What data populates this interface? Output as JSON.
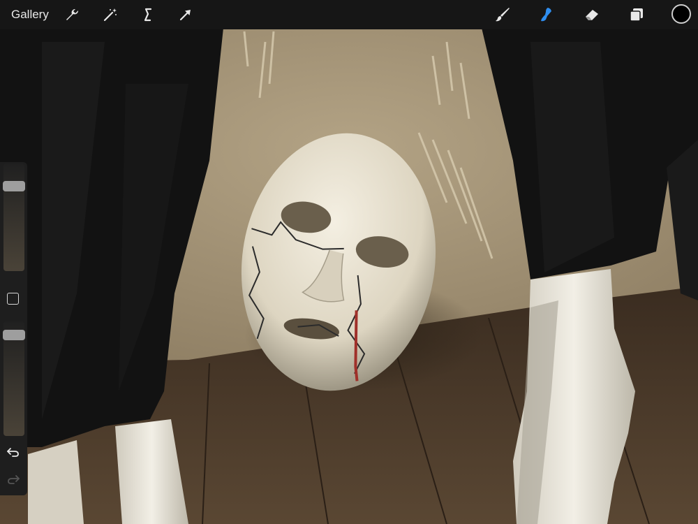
{
  "toolbar": {
    "gallery_label": "Gallery",
    "left_tools": [
      "wrench-icon",
      "magic-wand-icon",
      "selection-icon",
      "transform-arrow-icon"
    ],
    "right_tools": [
      "brush-icon",
      "smudge-icon",
      "eraser-icon",
      "layers-icon"
    ],
    "active_tool": "smudge",
    "accent_color": "#2f8ef0",
    "current_color": "#000000"
  },
  "sidebar": {
    "brush_size_level": 0.82,
    "opacity_level": 0.92,
    "controls": [
      "modify-button",
      "undo-icon",
      "redo-icon"
    ]
  },
  "canvas": {
    "colors": {
      "wall": "#a8977b",
      "floor": "#4a3a2a",
      "fabric": "#141414",
      "mask": "#ede6d4",
      "blood": "#a0302a"
    }
  }
}
